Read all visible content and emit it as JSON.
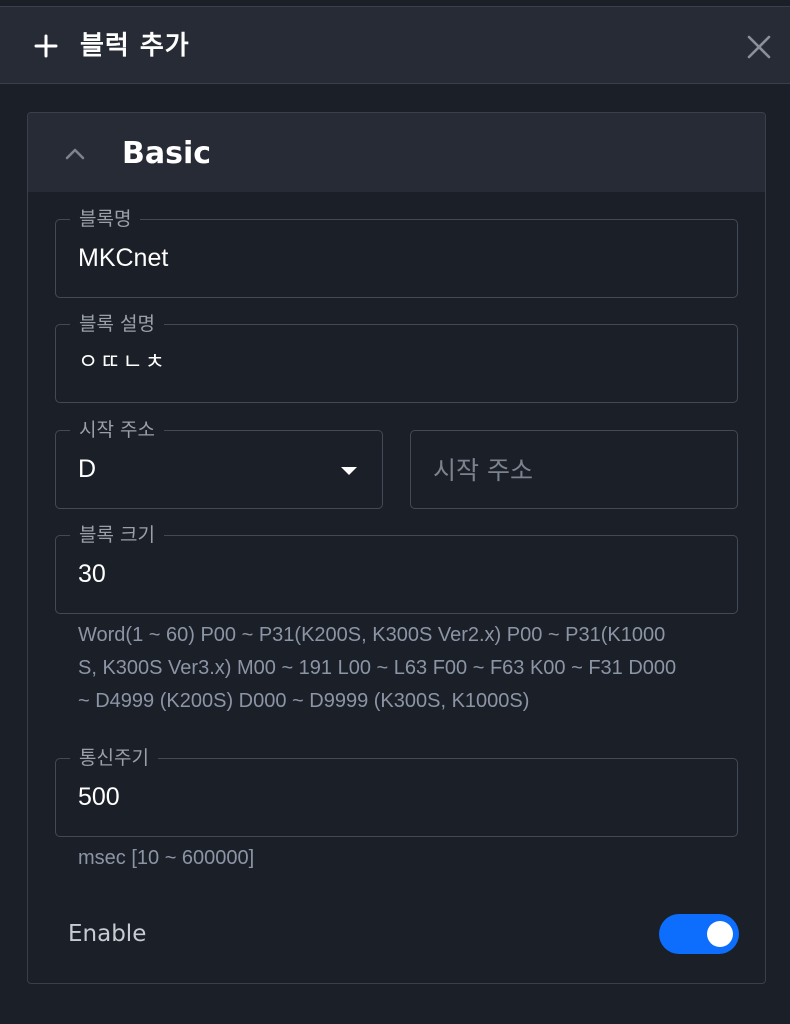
{
  "header": {
    "title": "블럭 추가",
    "add_icon": "plus-icon",
    "close_icon": "close-icon"
  },
  "section": {
    "title": "Basic",
    "collapse_icon": "chevron-up-icon"
  },
  "fields": {
    "block_name": {
      "label": "블록명",
      "value": "MKCnet"
    },
    "block_description": {
      "label": "블록 설명",
      "value": "ㅇㄸㄴㅊ"
    },
    "start_address": {
      "label": "시작 주소",
      "selected": "D",
      "placeholder": "시작 주소",
      "dropdown_icon": "caret-down-icon"
    },
    "block_size": {
      "label": "블록 크기",
      "value": "30",
      "helper_lines": [
        "Word(1 ~ 60) P00 ~ P31(K200S, K300S Ver2.x) P00 ~ P31(K1000",
        "S, K300S Ver3.x) M00 ~ 191 L00 ~ L63 F00 ~ F63 K00 ~ F31 D000",
        "~ D4999 (K200S) D000 ~ D9999 (K300S, K1000S)"
      ]
    },
    "comm_period": {
      "label": "통신주기",
      "value": "500",
      "helper": "msec [10 ~ 600000]"
    }
  },
  "enable": {
    "label": "Enable",
    "on": true
  },
  "colors": {
    "background": "#1b1f27",
    "header_bg": "#262b35",
    "accent": "#0d6efd",
    "border": "#444a55",
    "helper_text": "#8c95a6"
  }
}
